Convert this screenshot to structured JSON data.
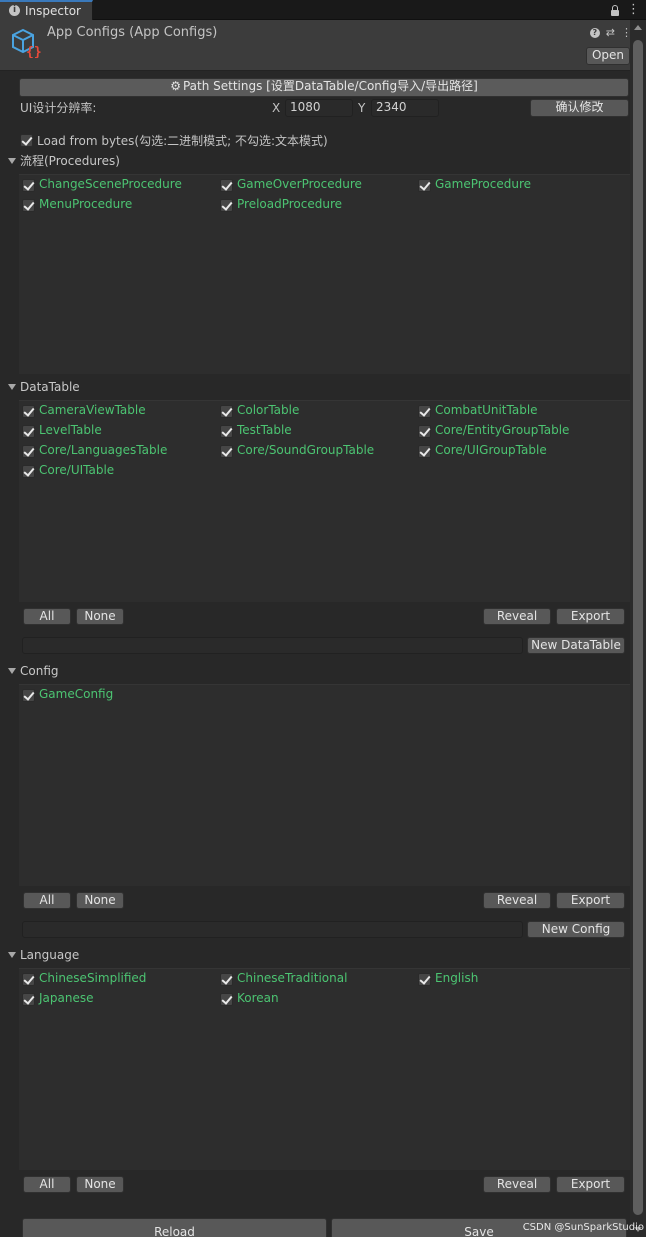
{
  "tab": {
    "title": "Inspector"
  },
  "header": {
    "title": "App Configs (App Configs)",
    "open_label": "Open"
  },
  "path_settings_label": "Path Settings [设置DataTable/Config导入/导出路径]",
  "resolution": {
    "label": "UI设计分辨率:",
    "x_label": "X",
    "x_value": "1080",
    "y_label": "Y",
    "y_value": "2340",
    "confirm_label": "确认修改"
  },
  "load_from_bytes": {
    "label": "Load from bytes(勾选:二进制模式; 不勾选:文本模式)",
    "checked": true
  },
  "procedures": {
    "title": "流程(Procedures)",
    "items": [
      "ChangeSceneProcedure",
      "GameOverProcedure",
      "GameProcedure",
      "MenuProcedure",
      "PreloadProcedure"
    ]
  },
  "datatable": {
    "title": "DataTable",
    "items": [
      "CameraViewTable",
      "ColorTable",
      "CombatUnitTable",
      "LevelTable",
      "TestTable",
      "Core/EntityGroupTable",
      "Core/LanguagesTable",
      "Core/SoundGroupTable",
      "Core/UIGroupTable",
      "Core/UITable"
    ],
    "all_label": "All",
    "none_label": "None",
    "reveal_label": "Reveal",
    "export_label": "Export",
    "new_value": "",
    "new_label": "New DataTable"
  },
  "config": {
    "title": "Config",
    "items": [
      "GameConfig"
    ],
    "all_label": "All",
    "none_label": "None",
    "reveal_label": "Reveal",
    "export_label": "Export",
    "new_value": "",
    "new_label": "New Config"
  },
  "language": {
    "title": "Language",
    "items": [
      "ChineseSimplified",
      "ChineseTraditional",
      "English",
      "Japanese",
      "Korean"
    ],
    "all_label": "All",
    "none_label": "None",
    "reveal_label": "Reveal",
    "export_label": "Export"
  },
  "bottom": {
    "reload_label": "Reload",
    "save_label": "Save"
  },
  "watermark": "CSDN @SunSparkStudio",
  "colors": {
    "item_text": "#4cc472",
    "background": "#282828",
    "panel": "#2d2d2d",
    "button": "#585858",
    "tab_accent": "#3a79bb"
  },
  "icons": {
    "tab": "info-icon",
    "lock": "lock-icon",
    "menu": "kebab-menu-icon",
    "asset": "app-configs-asset-icon",
    "help": "help-icon",
    "presets": "presets-icon",
    "gear": "gear-icon",
    "foldout": "foldout-arrow-icon"
  }
}
